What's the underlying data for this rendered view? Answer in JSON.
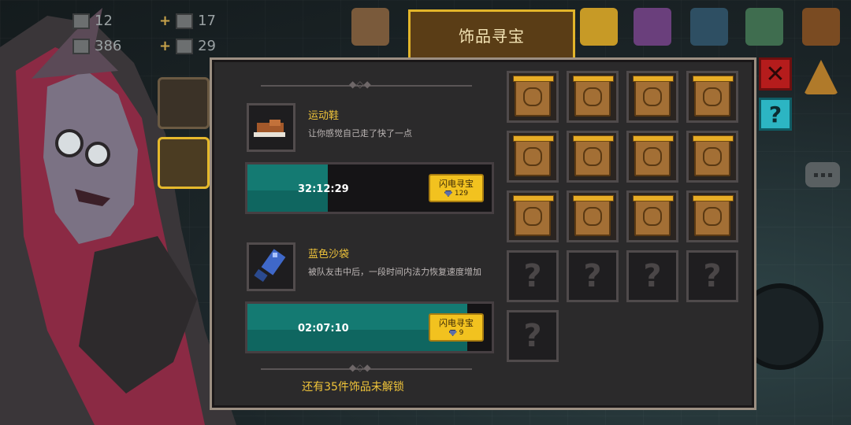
{
  "header": {
    "title": "饰品寻宝"
  },
  "resources": [
    {
      "value": "12",
      "icon": "gem-icon"
    },
    {
      "value": "386",
      "icon": "coin-icon"
    },
    {
      "value": "17",
      "icon": "material-icon"
    },
    {
      "value": "29",
      "icon": "material-icon"
    }
  ],
  "items": [
    {
      "name": "运动鞋",
      "description": "让你感觉自己走了快了一点",
      "timer": "32:12:29",
      "progress": 0.33,
      "action_label": "闪电寻宝",
      "cost": "129",
      "icon": "sneaker-icon"
    },
    {
      "name": "蓝色沙袋",
      "description": "被队友击中后，一段时间内法力恢复速度增加",
      "timer": "02:07:10",
      "progress": 0.9,
      "action_label": "闪电寻宝",
      "cost": "9",
      "icon": "blue-sandbag-icon"
    }
  ],
  "footer": {
    "locked_text": "还有35件饰品未解锁"
  },
  "grid": {
    "unlocked_count": 12,
    "locked_count": 5
  },
  "colors": {
    "accent_gold": "#f0c43a",
    "timer_teal": "#147a72",
    "close_red": "#b51c1c",
    "help_cyan": "#2cb5c3"
  }
}
